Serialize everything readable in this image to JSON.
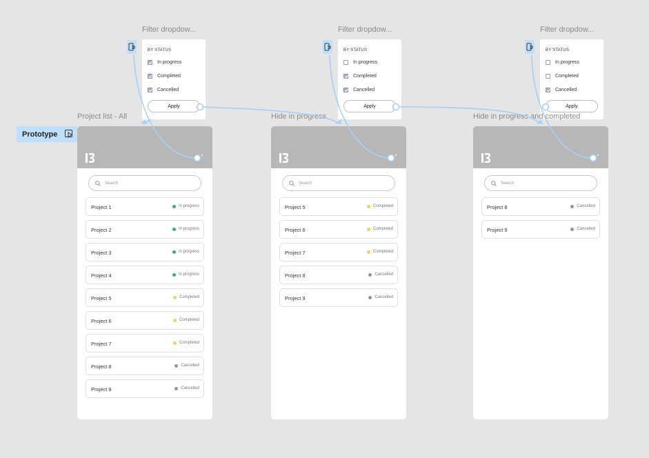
{
  "colors": {
    "canvas": "#e5e5e5",
    "header": "#b7b7b7",
    "prototype_blue": "#bfe0fb",
    "connector": "#a6d2f7",
    "in_progress": "#2fb087",
    "completed": "#f0d35c",
    "cancelled": "#8a97a6"
  },
  "prototype_badge": {
    "label": "Prototype",
    "icon": "play-frame-icon"
  },
  "dropdowns": [
    {
      "title": "Filter dropdow...",
      "heading": "BY STATUS",
      "options": [
        {
          "label": "In progress",
          "checked": true
        },
        {
          "label": "Completed",
          "checked": true
        },
        {
          "label": "Cancelled",
          "checked": true
        }
      ],
      "apply_label": "Apply"
    },
    {
      "title": "Filter dropdow...",
      "heading": "BY STATUS",
      "options": [
        {
          "label": "In progress",
          "checked": false
        },
        {
          "label": "Completed",
          "checked": true
        },
        {
          "label": "Cancelled",
          "checked": true
        }
      ],
      "apply_label": "Apply"
    },
    {
      "title": "Filter dropdow...",
      "heading": "BY STATUS",
      "options": [
        {
          "label": "In progress",
          "checked": false
        },
        {
          "label": "Completed",
          "checked": false
        },
        {
          "label": "Cancelled",
          "checked": true
        }
      ],
      "apply_label": "Apply"
    }
  ],
  "frames": [
    {
      "title": "Project list - All",
      "search_placeholder": "Search",
      "projects": [
        {
          "name": "Project 1",
          "status": "In progress"
        },
        {
          "name": "Project 2",
          "status": "In progress"
        },
        {
          "name": "Project 3",
          "status": "In progress"
        },
        {
          "name": "Project 4",
          "status": "In progress"
        },
        {
          "name": "Project 5",
          "status": "Completed"
        },
        {
          "name": "Project 6",
          "status": "Completed"
        },
        {
          "name": "Project 7",
          "status": "Completed"
        },
        {
          "name": "Project 8",
          "status": "Cancelled"
        },
        {
          "name": "Project 9",
          "status": "Cancelled"
        }
      ]
    },
    {
      "title": "Hide in progress",
      "search_placeholder": "Search",
      "projects": [
        {
          "name": "Project 5",
          "status": "Completed"
        },
        {
          "name": "Project 6",
          "status": "Completed"
        },
        {
          "name": "Project 7",
          "status": "Completed"
        },
        {
          "name": "Project 8",
          "status": "Cancelled"
        },
        {
          "name": "Project 9",
          "status": "Cancelled"
        }
      ]
    },
    {
      "title": "Hide in progress and completed",
      "search_placeholder": "Search",
      "projects": [
        {
          "name": "Project 8",
          "status": "Cancelled"
        },
        {
          "name": "Project 9",
          "status": "Cancelled"
        }
      ]
    }
  ]
}
